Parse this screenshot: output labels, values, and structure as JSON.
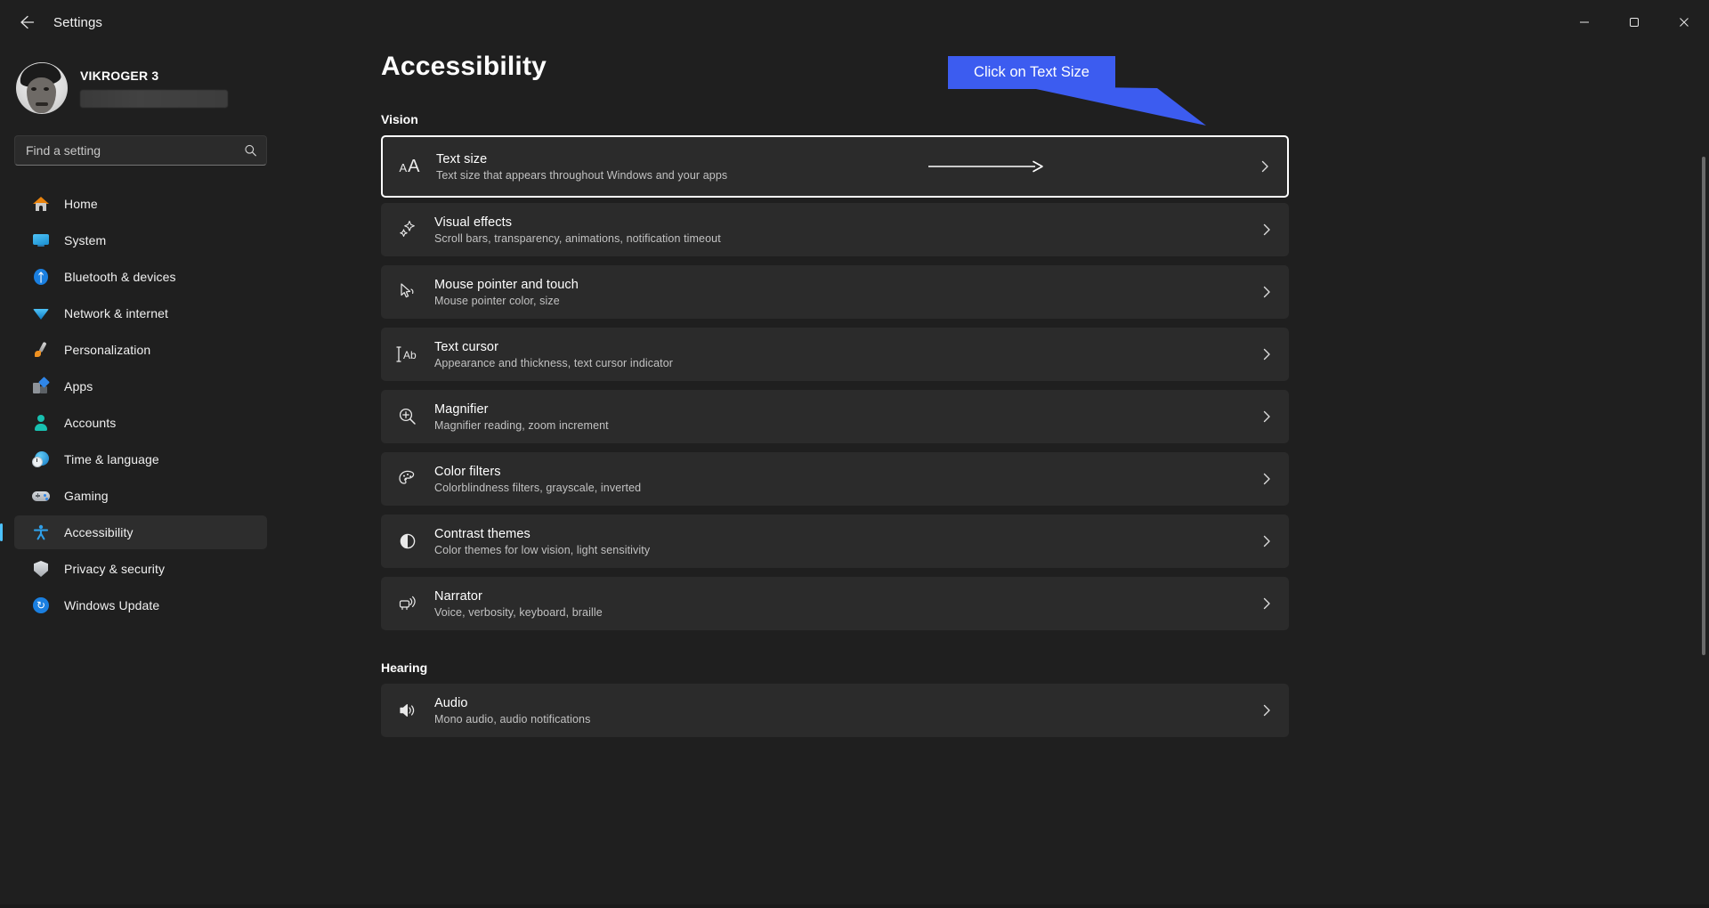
{
  "window": {
    "app_title": "Settings",
    "back_icon": "back-arrow-icon",
    "minimize_label": "─",
    "maximize_label": "□",
    "close_label": "✕"
  },
  "account": {
    "name": "VIKROGER 3",
    "email_redacted": true
  },
  "search": {
    "placeholder": "Find a setting",
    "value": "",
    "icon": "search-icon"
  },
  "sidebar": {
    "items": [
      {
        "label": "Home",
        "icon": "home-icon",
        "selected": false
      },
      {
        "label": "System",
        "icon": "monitor-icon",
        "selected": false
      },
      {
        "label": "Bluetooth & devices",
        "icon": "bluetooth-icon",
        "selected": false
      },
      {
        "label": "Network & internet",
        "icon": "wifi-icon",
        "selected": false
      },
      {
        "label": "Personalization",
        "icon": "paintbrush-icon",
        "selected": false
      },
      {
        "label": "Apps",
        "icon": "apps-icon",
        "selected": false
      },
      {
        "label": "Accounts",
        "icon": "person-icon",
        "selected": false
      },
      {
        "label": "Time & language",
        "icon": "globe-clock-icon",
        "selected": false
      },
      {
        "label": "Gaming",
        "icon": "gamepad-icon",
        "selected": false
      },
      {
        "label": "Accessibility",
        "icon": "accessibility-person-icon",
        "selected": true
      },
      {
        "label": "Privacy & security",
        "icon": "shield-icon",
        "selected": false
      },
      {
        "label": "Windows Update",
        "icon": "update-refresh-icon",
        "selected": false
      }
    ]
  },
  "main": {
    "page_title": "Accessibility",
    "sections": [
      {
        "heading": "Vision",
        "items": [
          {
            "title": "Text size",
            "subtitle": "Text size that appears throughout Windows and your apps",
            "icon": "text-size-aa-icon",
            "highlighted": true,
            "has_inner_arrow": true
          },
          {
            "title": "Visual effects",
            "subtitle": "Scroll bars, transparency, animations, notification timeout",
            "icon": "sparkles-icon",
            "highlighted": false,
            "has_inner_arrow": false
          },
          {
            "title": "Mouse pointer and touch",
            "subtitle": "Mouse pointer color, size",
            "icon": "mouse-pointer-icon",
            "highlighted": false,
            "has_inner_arrow": false
          },
          {
            "title": "Text cursor",
            "subtitle": "Appearance and thickness, text cursor indicator",
            "icon": "text-cursor-icon",
            "highlighted": false,
            "has_inner_arrow": false
          },
          {
            "title": "Magnifier",
            "subtitle": "Magnifier reading, zoom increment",
            "icon": "magnifier-icon",
            "highlighted": false,
            "has_inner_arrow": false
          },
          {
            "title": "Color filters",
            "subtitle": "Colorblindness filters, grayscale, inverted",
            "icon": "palette-icon",
            "highlighted": false,
            "has_inner_arrow": false
          },
          {
            "title": "Contrast themes",
            "subtitle": "Color themes for low vision, light sensitivity",
            "icon": "contrast-circle-icon",
            "highlighted": false,
            "has_inner_arrow": false
          },
          {
            "title": "Narrator",
            "subtitle": "Voice, verbosity, keyboard, braille",
            "icon": "narrator-icon",
            "highlighted": false,
            "has_inner_arrow": false
          }
        ]
      },
      {
        "heading": "Hearing",
        "items": [
          {
            "title": "Audio",
            "subtitle": "Mono audio, audio notifications",
            "icon": "speaker-icon",
            "highlighted": false,
            "has_inner_arrow": false
          }
        ]
      }
    ],
    "chevron_icon": "chevron-right-icon"
  },
  "annotation": {
    "callout_text": "Click on Text Size",
    "callout_color": "#3c5cf0",
    "pointer_icon": "arrow-pointer-shape"
  }
}
